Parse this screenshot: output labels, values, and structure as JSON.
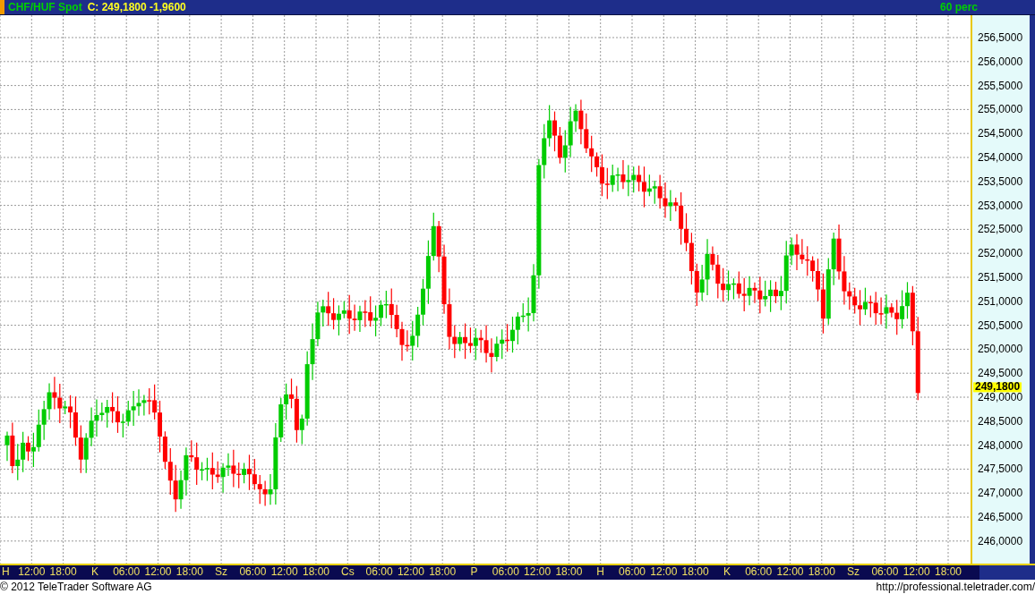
{
  "header": {
    "symbol": "CHF/HUF Spot",
    "quote": "C: 249,1800 -1,9600",
    "interval": "60 perc"
  },
  "y_axis": {
    "labels": [
      "256,5000",
      "256,0000",
      "255,5000",
      "255,0000",
      "254,5000",
      "254,0000",
      "253,5000",
      "253,0000",
      "252,5000",
      "252,0000",
      "251,5000",
      "251,0000",
      "250,5000",
      "250,0000",
      "249,5000",
      "249,0000",
      "248,5000",
      "248,0000",
      "247,5000",
      "247,0000",
      "246,5000",
      "246,0000"
    ],
    "last_price": "249,1800"
  },
  "x_axis": {
    "labels": [
      "H",
      "12:00",
      "18:00",
      "K",
      "06:00",
      "12:00",
      "18:00",
      "Sz",
      "06:00",
      "12:00",
      "18:00",
      "Cs",
      "06:00",
      "12:00",
      "18:00",
      "P",
      "06:00",
      "12:00",
      "18:00",
      "H",
      "06:00",
      "12:00",
      "18:00",
      "K",
      "06:00",
      "12:00",
      "18:00",
      "Sz",
      "06:00",
      "12:00",
      "18:00"
    ]
  },
  "footer": {
    "copyright": "© 2012 TeleTrader Software AG",
    "url": "http://professional.teletrader.com/"
  }
}
